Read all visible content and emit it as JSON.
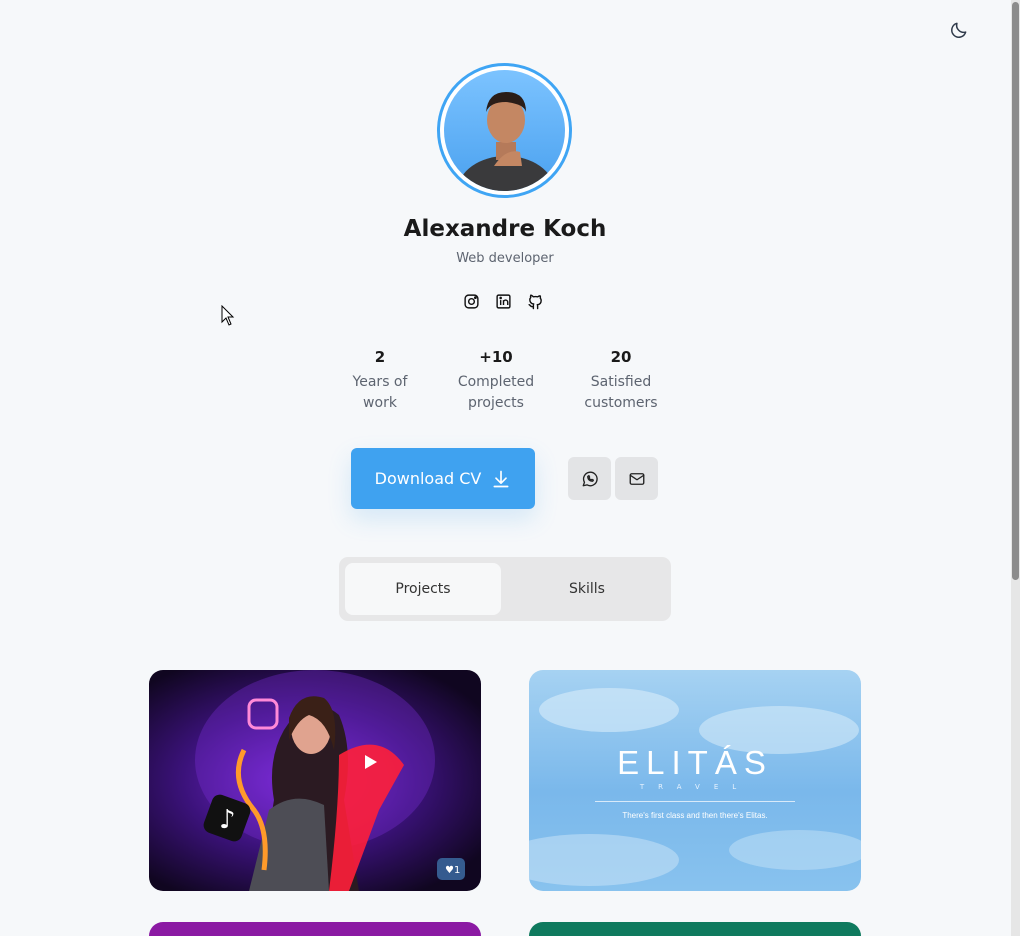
{
  "profile": {
    "name": "Alexandre Koch",
    "role": "Web developer"
  },
  "socials": [
    {
      "icon": "instagram-icon"
    },
    {
      "icon": "linkedin-icon"
    },
    {
      "icon": "github-icon"
    }
  ],
  "stats": [
    {
      "value": "2",
      "label_line1": "Years of",
      "label_line2": "work"
    },
    {
      "value": "+10",
      "label_line1": "Completed",
      "label_line2": "projects"
    },
    {
      "value": "20",
      "label_line1": "Satisfied",
      "label_line2": "customers"
    }
  ],
  "actions": {
    "download_label": "Download CV",
    "whatsapp_icon": "whatsapp-icon",
    "mail_icon": "mail-icon"
  },
  "tabs": [
    {
      "label": "Projects",
      "active": true
    },
    {
      "label": "Skills",
      "active": false
    }
  ],
  "projects": {
    "elitas": {
      "title": "ELITÁS",
      "subtitle": "TRAVEL",
      "tagline": "There's first class and then there's Elitas."
    }
  },
  "colors": {
    "accent": "#3fa2f0",
    "background": "#f6f8fa"
  }
}
